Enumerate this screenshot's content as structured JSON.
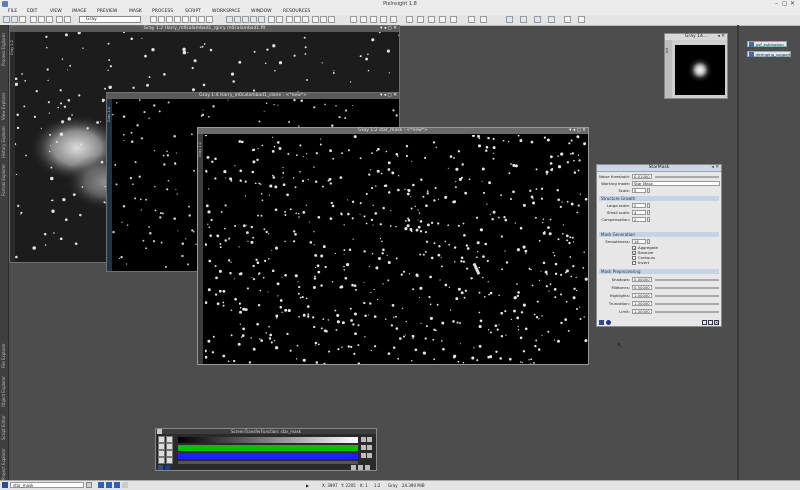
{
  "app": {
    "title": "PixInsight 1.8",
    "window_controls": [
      "–",
      "▢",
      "✕"
    ]
  },
  "menu": [
    "FILE",
    "EDIT",
    "VIEW",
    "IMAGE",
    "PREVIEW",
    "MASK",
    "PROCESS",
    "SCRIPT",
    "WORKSPACE",
    "WINDOW",
    "RESOURCES"
  ],
  "toolbar": {
    "view_selector": "Gray"
  },
  "left_tabs": [
    "Process Explorer",
    "View Explorer",
    "History Explorer",
    "Format Explorer",
    "File Explorer",
    "Object Explorer",
    "Script Editor",
    "Project Explorer"
  ],
  "windows": {
    "gray12": {
      "title": "Gray 1:2 Harry_m0calambad1_rgnry m0calambad1.fit",
      "tab": "Gray 1:2"
    },
    "gray14": {
      "title": "Gray 1:4 Harry_m0calambad1_clone : <*new*>",
      "tab": "Gray 1:4"
    },
    "star_mask": {
      "title": "Gray 1:2 star_mask : <*new*>",
      "tab": "Gray 1:2"
    },
    "preview_small": {
      "title": "Gray 14...",
      "tab": "psf"
    }
  },
  "desktop_icons": [
    "psf_estimation",
    "deringing_support"
  ],
  "starmask": {
    "title": "StarMask",
    "noise_threshold_label": "Noise threshold:",
    "noise_threshold": "0.01000",
    "working_mode_label": "Working mode:",
    "working_mode": "Star Mask",
    "scale_label": "Scale:",
    "scale": "5",
    "structure_growth_header": "Structure Growth",
    "large_scale_label": "Large-scale:",
    "large_scale": "2",
    "small_scale_label": "Small-scale:",
    "small_scale": "4",
    "compensation_label": "Compensation:",
    "compensation": "2",
    "mask_generation_header": "Mask Generation",
    "smoothness_label": "Smoothness:",
    "smoothness": "16",
    "aggregate_label": "Aggregate",
    "binarize_label": "Binarize",
    "contours_label": "Contours",
    "invert_label": "Invert",
    "aggregate": true,
    "binarize": true,
    "contours": false,
    "invert": false,
    "mask_preprocessing_header": "Mask Preprocessing",
    "shadows_label": "Shadows:",
    "shadows": "0.00000",
    "midtones_label": "Midtones:",
    "midtones": "0.50000",
    "highlights_label": "Highlights:",
    "highlights": "1.00000",
    "truncation_label": "Truncation:",
    "truncation": "1.00000",
    "limit_label": "Limit:",
    "limit": "1.00000"
  },
  "stf": {
    "title": "ScreenTransferFunction: star_mask"
  },
  "status": {
    "view_id": "star_mask",
    "x": "X: 3997",
    "y": "Y: 2205",
    "k": "K: 1",
    "zoom": "1:2",
    "mode": "Gray",
    "size": "24.390 MiB"
  },
  "colors": {
    "accent": "#5a7fb8",
    "stf_green": "#00c000",
    "stf_blue": "#1a22ff",
    "desktop": "#4d4d4d"
  }
}
